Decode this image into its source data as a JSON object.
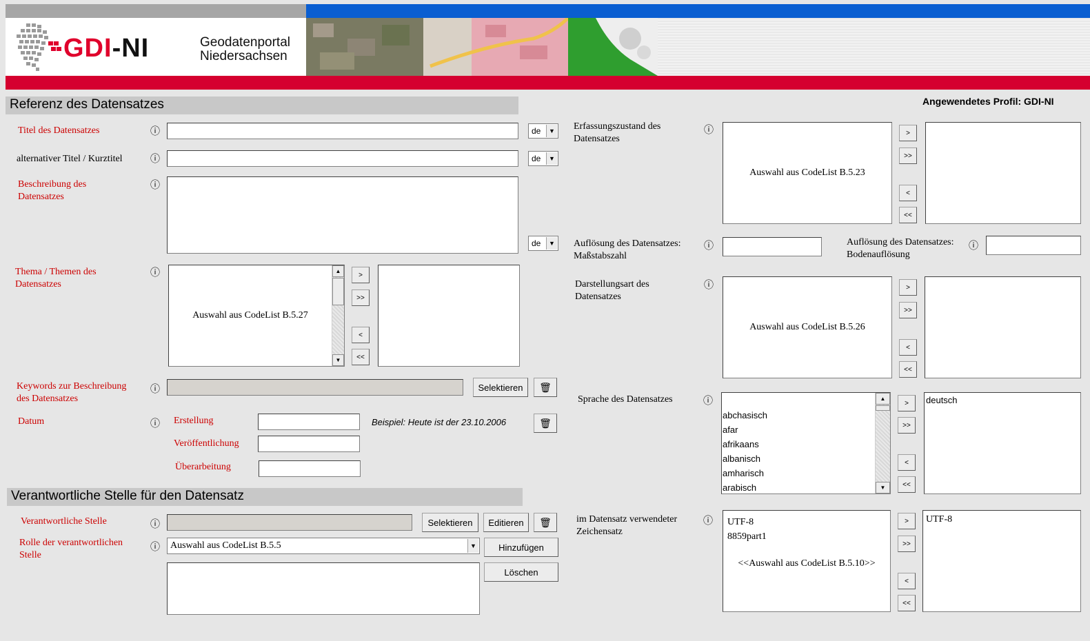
{
  "header": {
    "logo_part1": "GDI",
    "logo_part2": "-NI",
    "portal_line1": "Geodatenportal",
    "portal_line2": "Niedersachsen",
    "profile": "Angewendetes Profil: GDI-NI"
  },
  "section1": {
    "title": "Referenz des Datensatzes",
    "titel_label": "Titel des Datensatzes",
    "titel_lang": "de",
    "alt_titel_label": "alternativer Titel / Kurztitel",
    "alt_titel_lang": "de",
    "beschreibung_label_1": "Beschreibung des",
    "beschreibung_label_2": "Datensatzes",
    "beschreibung_lang": "de",
    "thema_label_1": "Thema / Themen des",
    "thema_label_2": "Datensatzes",
    "thema_placeholder": "Auswahl aus CodeList B.5.27",
    "keywords_label_1": "Keywords zur Beschreibung",
    "keywords_label_2": "des Datensatzes",
    "selektieren": "Selektieren",
    "datum_label": "Datum",
    "erstellung": "Erstellung",
    "veroeffentlichung": "Veröffentlichung",
    "ueberarbeitung": "Überarbeitung",
    "beispiel": "Beispiel: Heute ist der 23.10.2006"
  },
  "section2": {
    "title": "Verantwortliche Stelle für den Datensatz",
    "stelle_label": "Verantwortliche Stelle",
    "selektieren": "Selektieren",
    "editieren": "Editieren",
    "rolle_label_1": "Rolle der verantwortlichen",
    "rolle_label_2": "Stelle",
    "rolle_value": "Auswahl aus CodeList B.5.5",
    "hinzufuegen": "Hinzufügen",
    "loeschen": "Löschen"
  },
  "right": {
    "erfassung_label_1": "Erfassungszustand des",
    "erfassung_label_2": "Datensatzes",
    "erfassung_placeholder": "Auswahl aus CodeList B.5.23",
    "aufl_mass_label_1": "Auflösung des Datensatzes:",
    "aufl_mass_label_2": "Maßstabszahl",
    "aufl_boden_label_1": "Auflösung des Datensatzes:",
    "aufl_boden_label_2": "Bodenauflösung",
    "darstellung_label_1": "Darstellungsart des",
    "darstellung_label_2": "Datensatzes",
    "darstellung_placeholder": "Auswahl aus CodeList B.5.26",
    "sprache_label": "Sprache des Datensatzes",
    "sprache_options": [
      "abchasisch",
      "afar",
      "afrikaans",
      "albanisch",
      "amharisch",
      "arabisch"
    ],
    "sprache_selected": "deutsch",
    "zeichensatz_label_1": "im Datensatz verwendeter",
    "zeichensatz_label_2": "Zeichensatz",
    "zeichensatz_options": [
      "UTF-8",
      "8859part1"
    ],
    "zeichensatz_hint": "<<Auswahl aus CodeList B.5.10>>",
    "zeichensatz_selected": "UTF-8"
  },
  "common": {
    "info": "ⓘ",
    "btn_add": ">",
    "btn_add_all": ">>",
    "btn_remove": "<",
    "btn_remove_all": "<<"
  }
}
